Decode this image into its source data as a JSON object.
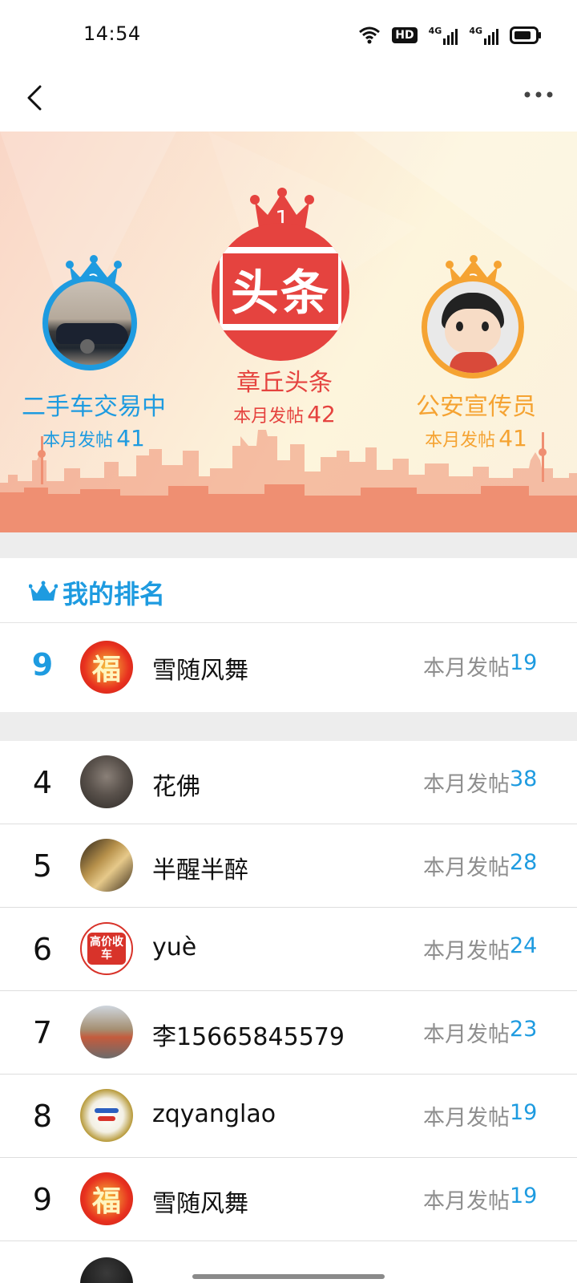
{
  "status_bar": {
    "time": "14:54",
    "hd_label": "HD",
    "net1": "4G",
    "net2": "4G"
  },
  "podium": [
    {
      "rank": "2",
      "name": "二手车交易中",
      "count_label": "本月发帖",
      "count": "41",
      "color": "#1e9be0"
    },
    {
      "rank": "1",
      "name": "章丘头条",
      "count_label": "本月发帖",
      "count": "42",
      "color": "#e5433f",
      "logo_text": "头条"
    },
    {
      "rank": "3",
      "name": "公安宣传员",
      "count_label": "本月发帖",
      "count": "41",
      "color": "#f5a332"
    }
  ],
  "my_rank": {
    "title": "我的排名",
    "rank": "9",
    "name": "雪随风舞",
    "count_label": "本月发帖",
    "count": "19",
    "avatar_text": "福"
  },
  "list": [
    {
      "rank": "4",
      "name": "花佛",
      "count_label": "本月发帖",
      "count": "38"
    },
    {
      "rank": "5",
      "name": "半醒半醉",
      "count_label": "本月发帖",
      "count": "28"
    },
    {
      "rank": "6",
      "name": "yuè",
      "count_label": "本月发帖",
      "count": "24",
      "avatar_text": "高价收车"
    },
    {
      "rank": "7",
      "name": "李15665845579",
      "count_label": "本月发帖",
      "count": "23"
    },
    {
      "rank": "8",
      "name": "zqyanglao",
      "count_label": "本月发帖",
      "count": "19"
    },
    {
      "rank": "9",
      "name": "雪随风舞",
      "count_label": "本月发帖",
      "count": "19",
      "avatar_text": "福"
    }
  ],
  "colors": {
    "accent": "#1e9be0",
    "first": "#e5433f",
    "third": "#f5a332",
    "skyline": "#ef8f72"
  }
}
